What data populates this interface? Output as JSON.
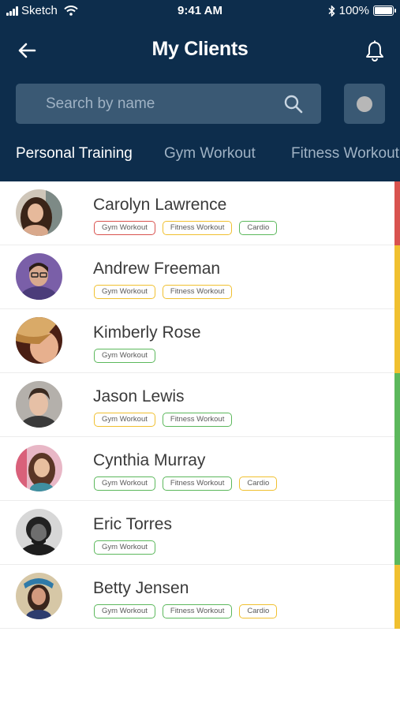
{
  "status_bar": {
    "carrier": "Sketch",
    "time": "9:41 AM",
    "battery": "100%"
  },
  "header": {
    "title": "My Clients"
  },
  "search": {
    "placeholder": "Search by name"
  },
  "tabs": [
    {
      "label": "Personal Training",
      "active": true
    },
    {
      "label": "Gym Workout",
      "active": false
    },
    {
      "label": "Fitness Workout",
      "active": false
    }
  ],
  "colors": {
    "header_bg": "#0d2d4c",
    "red": "#d9534f",
    "yellow": "#f0c030",
    "green": "#5cb85c"
  },
  "clients": [
    {
      "name": "Carolyn Lawrence",
      "status_color": "red",
      "tags": [
        {
          "label": "Gym Workout",
          "color": "red"
        },
        {
          "label": "Fitness Workout",
          "color": "yellow"
        },
        {
          "label": "Cardio",
          "color": "green"
        }
      ]
    },
    {
      "name": "Andrew Freeman",
      "status_color": "yellow",
      "tags": [
        {
          "label": "Gym Workout",
          "color": "yellow"
        },
        {
          "label": "Fitness Workout",
          "color": "yellow"
        }
      ]
    },
    {
      "name": "Kimberly Rose",
      "status_color": "yellow",
      "tags": [
        {
          "label": "Gym Workout",
          "color": "green"
        }
      ]
    },
    {
      "name": "Jason Lewis",
      "status_color": "green",
      "tags": [
        {
          "label": "Gym Workout",
          "color": "yellow"
        },
        {
          "label": "Fitness Workout",
          "color": "green"
        }
      ]
    },
    {
      "name": "Cynthia Murray",
      "status_color": "green",
      "tags": [
        {
          "label": "Gym Workout",
          "color": "green"
        },
        {
          "label": "Fitness Workout",
          "color": "green"
        },
        {
          "label": "Cardio",
          "color": "yellow"
        }
      ]
    },
    {
      "name": "Eric Torres",
      "status_color": "green",
      "tags": [
        {
          "label": "Gym Workout",
          "color": "green"
        }
      ]
    },
    {
      "name": "Betty Jensen",
      "status_color": "yellow",
      "tags": [
        {
          "label": "Gym Workout",
          "color": "green"
        },
        {
          "label": "Fitness Workout",
          "color": "green"
        },
        {
          "label": "Cardio",
          "color": "yellow"
        }
      ]
    }
  ]
}
